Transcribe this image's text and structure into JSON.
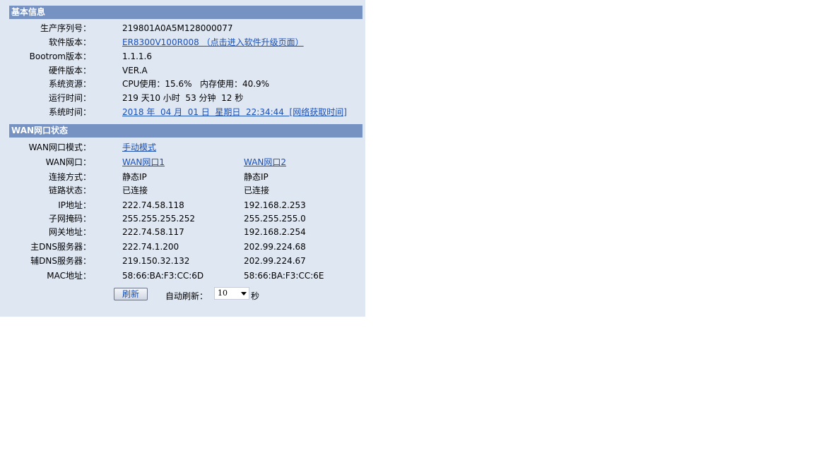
{
  "basic_info": {
    "header": "基本信息",
    "rows": [
      {
        "label": "生产序列号：",
        "value": "219801A0A5M128000077"
      },
      {
        "label": "软件版本：",
        "value": "ER8300V100R008 （点击进入软件升级页面）"
      },
      {
        "label": "Bootrom版本：",
        "value": "1.1.1.6"
      },
      {
        "label": "硬件版本：",
        "value": "VER.A"
      },
      {
        "label": "系统资源：",
        "value": "CPU使用：15.6%   内存使用：40.9%"
      },
      {
        "label": "运行时间：",
        "value": "219 天10 小时  53 分钟  12 秒"
      },
      {
        "label": "系统时间：",
        "value": "2018 年  04 月  01 日  星期日  22:34:44  [网络获取时间]"
      }
    ]
  },
  "wan_status": {
    "header": "WAN网口状态",
    "mode_label": "WAN网口模式：",
    "mode_value": "手动模式",
    "port_label": "WAN网口：",
    "ports": [
      "WAN网口1",
      "WAN网口2"
    ],
    "rows": [
      {
        "label": "连接方式：",
        "v1": "静态IP",
        "v2": "静态IP"
      },
      {
        "label": "链路状态：",
        "v1": "已连接",
        "v2": "已连接"
      },
      {
        "label": "IP地址：",
        "v1": "222.74.58.118",
        "v2": "192.168.2.253"
      },
      {
        "label": "子网掩码：",
        "v1": "255.255.255.252",
        "v2": "255.255.255.0"
      },
      {
        "label": "网关地址：",
        "v1": "222.74.58.117",
        "v2": "192.168.2.254"
      },
      {
        "label": "主DNS服务器：",
        "v1": "222.74.1.200",
        "v2": "202.99.224.68"
      },
      {
        "label": "辅DNS服务器：",
        "v1": "219.150.32.132",
        "v2": "202.99.224.67"
      },
      {
        "label": "MAC地址：",
        "v1": "58:66:BA:F3:CC:6D",
        "v2": "58:66:BA:F3:CC:6E"
      }
    ]
  },
  "controls": {
    "refresh_label": "刷新",
    "auto_refresh_label": "自动刷新：",
    "auto_refresh_value": "10",
    "seconds_unit": "秒"
  },
  "colors": {
    "header_bg": "#7592c3",
    "panel_bg": "#dfe7f3",
    "link": "#1a50b8"
  }
}
